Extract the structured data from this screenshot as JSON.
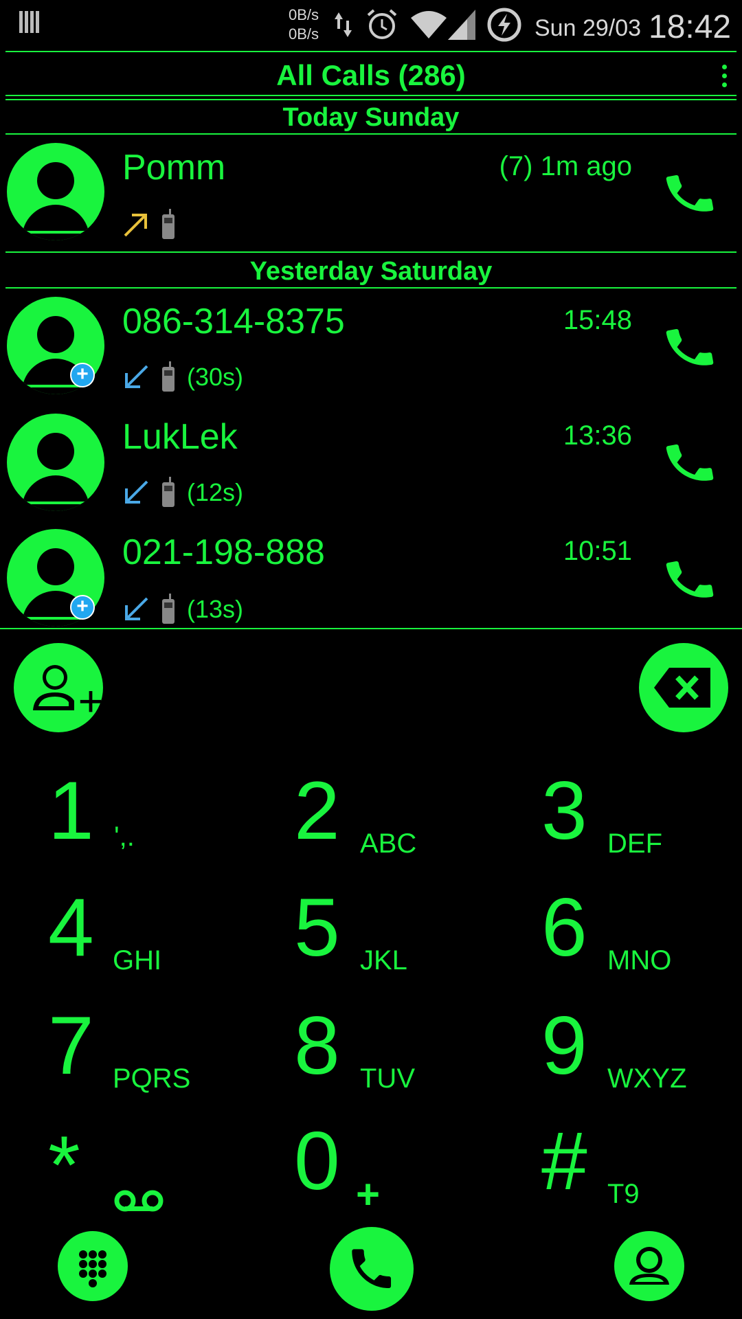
{
  "status_bar": {
    "net_up": "0B/s",
    "net_down": "0B/s",
    "date": "Sun 29/03",
    "time": "18:42",
    "icons": [
      "notification-bars-icon",
      "data-transfer-icon",
      "alarm-icon",
      "wifi-icon",
      "signal-icon",
      "battery-charging-icon"
    ]
  },
  "header": {
    "title": "All Calls (286)",
    "menu_icon": "overflow-menu-icon"
  },
  "sections": [
    {
      "label": "Today  Sunday"
    },
    {
      "label": "Yesterday  Saturday"
    }
  ],
  "calls": [
    {
      "name": "Pomm",
      "time": "(7) 1m ago",
      "direction": "outgoing",
      "duration": "",
      "has_add_badge": false
    },
    {
      "name": "086-314-8375",
      "time": "15:48",
      "direction": "incoming",
      "duration": "(30s)",
      "has_add_badge": true
    },
    {
      "name": "LukLek",
      "time": "13:36",
      "direction": "incoming",
      "duration": "(12s)",
      "has_add_badge": false
    },
    {
      "name": "021-198-888",
      "time": "10:51",
      "direction": "incoming",
      "duration": "(13s)",
      "has_add_badge": true
    }
  ],
  "keypad": [
    {
      "digit": "1",
      "letters": "',."
    },
    {
      "digit": "2",
      "letters": "ABC"
    },
    {
      "digit": "3",
      "letters": "DEF"
    },
    {
      "digit": "4",
      "letters": "GHI"
    },
    {
      "digit": "5",
      "letters": "JKL"
    },
    {
      "digit": "6",
      "letters": "MNO"
    },
    {
      "digit": "7",
      "letters": "PQRS"
    },
    {
      "digit": "8",
      "letters": "TUV"
    },
    {
      "digit": "9",
      "letters": "WXYZ"
    },
    {
      "digit": "*",
      "letters": ""
    },
    {
      "digit": "0",
      "letters": "+"
    },
    {
      "digit": "#",
      "letters": "T9"
    }
  ],
  "colors": {
    "accent": "#19f43e",
    "background": "#000000",
    "incoming": "#4aa8e6",
    "outgoing": "#e8c13a",
    "badge": "#21a7f0"
  }
}
